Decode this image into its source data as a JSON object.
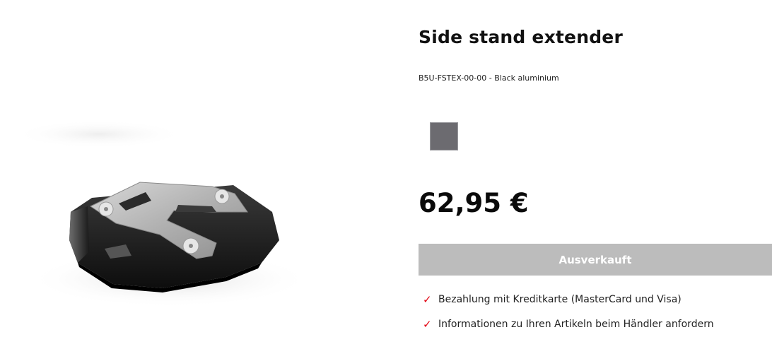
{
  "product": {
    "title": "Side stand extender",
    "sku_line": "B5U-FSTEX-00-00 - Black aluminium",
    "image_alt": "side-stand-extender-photo",
    "swatch": {
      "name": "Black aluminium",
      "color": "#6c6b70"
    },
    "price": "62,95 €",
    "button_label": "Ausverkauft",
    "features": [
      {
        "icon": "checkmark-icon",
        "glyph": "✓",
        "text": "Bezahlung mit Kreditkarte (MasterCard und Visa)"
      },
      {
        "icon": "checkmark-icon",
        "glyph": "✓",
        "text": "Informationen zu Ihren Artikeln beim Händler anfordern"
      }
    ]
  },
  "colors": {
    "accent": "#e30613",
    "button_disabled": "#bcbcbc",
    "text": "#111111"
  }
}
